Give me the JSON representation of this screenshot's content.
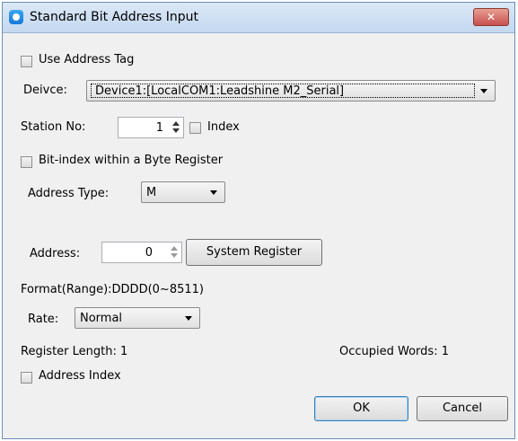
{
  "window": {
    "title": "Standard Bit Address Input",
    "close_glyph": "✕"
  },
  "use_address_tag": {
    "label": "Use Address Tag",
    "checked": false
  },
  "device": {
    "label": "Deivce:",
    "value": "Device1:[LocalCOM1:Leadshine M2_Serial]"
  },
  "station": {
    "label": "Station No:",
    "value": "1",
    "index_label": "Index"
  },
  "bit_index": {
    "label": "Bit-index within a Byte Register",
    "checked": false
  },
  "address_type": {
    "label": "Address Type:",
    "value": "M"
  },
  "address": {
    "label": "Address:",
    "value": "0",
    "system_register_button": "System Register"
  },
  "format_range": "Format(Range):DDDD(0~8511)",
  "rate": {
    "label": "Rate:",
    "value": "Normal"
  },
  "register_length": "Register Length: 1",
  "occupied_words": "Occupied Words: 1",
  "address_index": {
    "label": "Address Index",
    "checked": false
  },
  "buttons": {
    "ok": "OK",
    "cancel": "Cancel"
  },
  "icons": {
    "title": "app-icon",
    "close": "close-icon",
    "dropdown": "chevron-down-icon",
    "spin": "spinner-arrows-icon"
  }
}
